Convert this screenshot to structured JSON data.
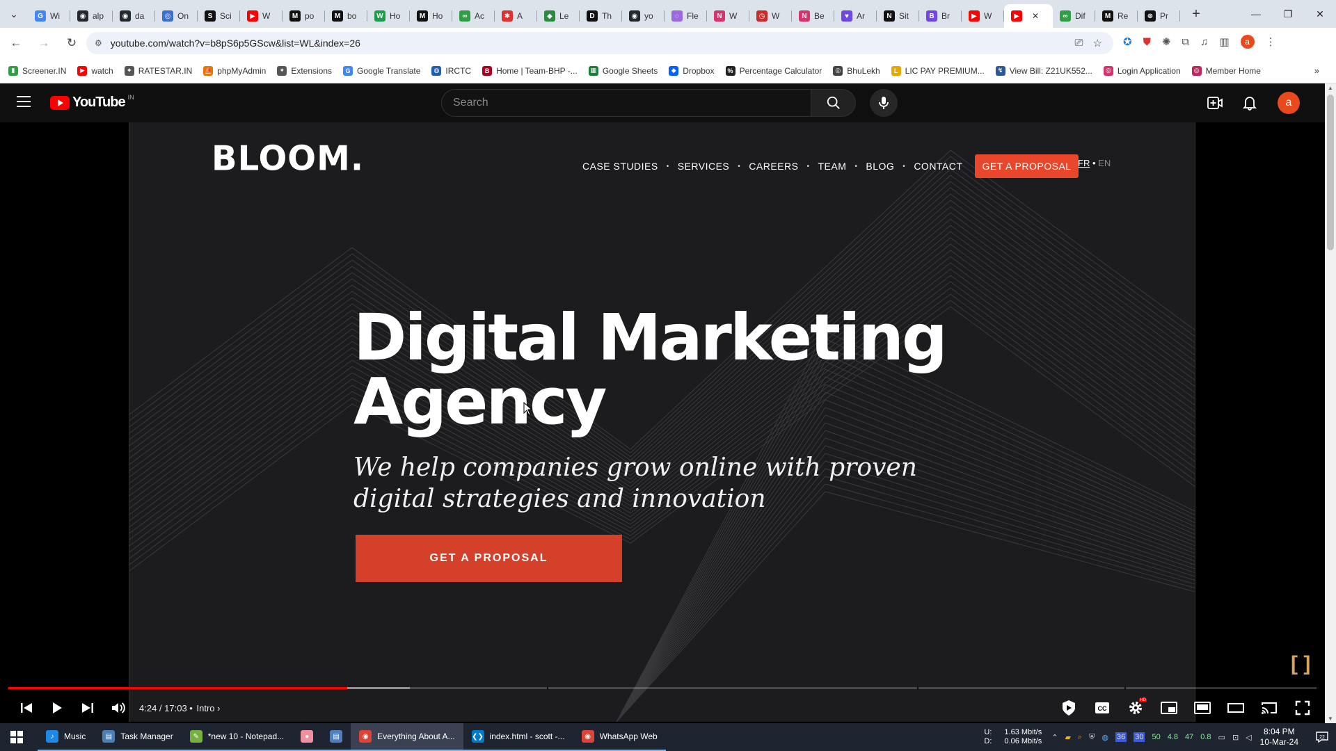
{
  "browser": {
    "tabs": [
      {
        "title": "Wi",
        "icon": "google-icon",
        "color": "#4285f4",
        "glyph": "G"
      },
      {
        "title": "alp",
        "icon": "github-icon",
        "color": "#24292f",
        "glyph": "◉"
      },
      {
        "title": "da",
        "icon": "github-icon",
        "color": "#24292f",
        "glyph": "◉"
      },
      {
        "title": "On",
        "icon": "globe-icon",
        "color": "#3b6fd4",
        "glyph": "◎"
      },
      {
        "title": "Sci",
        "icon": "s-icon",
        "color": "#111111",
        "glyph": "S"
      },
      {
        "title": "W",
        "icon": "youtube-icon",
        "color": "#ff0000",
        "glyph": "▶"
      },
      {
        "title": "po",
        "icon": "medium-icon",
        "color": "#111111",
        "glyph": "M"
      },
      {
        "title": "bo",
        "icon": "medium-icon",
        "color": "#111111",
        "glyph": "M"
      },
      {
        "title": "Ho",
        "icon": "w-icon",
        "color": "#1a9e4a",
        "glyph": "W"
      },
      {
        "title": "Ho",
        "icon": "medium-icon",
        "color": "#111111",
        "glyph": "M"
      },
      {
        "title": "Ac",
        "icon": "link-icon",
        "color": "#2f9e44",
        "glyph": "∞"
      },
      {
        "title": "A",
        "icon": "asterisk-icon",
        "color": "#e03131",
        "glyph": "✱"
      },
      {
        "title": "Le",
        "icon": "shield-icon",
        "color": "#2b8a3e",
        "glyph": "◆"
      },
      {
        "title": "Th",
        "icon": "dev-icon",
        "color": "#111111",
        "glyph": "D"
      },
      {
        "title": "yo",
        "icon": "github-icon",
        "color": "#24292f",
        "glyph": "◉"
      },
      {
        "title": "Fle",
        "icon": "circle-icon",
        "color": "#9c6ade",
        "glyph": "◌"
      },
      {
        "title": "W",
        "icon": "nn-icon",
        "color": "#d6336c",
        "glyph": "N"
      },
      {
        "title": "W",
        "icon": "clock-icon",
        "color": "#c92a2a",
        "glyph": "◷"
      },
      {
        "title": "Be",
        "icon": "nn-icon",
        "color": "#d6336c",
        "glyph": "N"
      },
      {
        "title": "Ar",
        "icon": "heart-icon",
        "color": "#7048e8",
        "glyph": "♥"
      },
      {
        "title": "Sit",
        "icon": "n-icon",
        "color": "#111111",
        "glyph": "N"
      },
      {
        "title": "Br",
        "icon": "b-icon",
        "color": "#7048e8",
        "glyph": "B"
      },
      {
        "title": "W",
        "icon": "youtube-icon",
        "color": "#ff0000",
        "glyph": "▶"
      },
      {
        "title": "",
        "icon": "youtube-icon",
        "color": "#ff0000",
        "glyph": "▶",
        "active": true
      },
      {
        "title": "Dif",
        "icon": "link-icon",
        "color": "#2f9e44",
        "glyph": "∞"
      },
      {
        "title": "Re",
        "icon": "medium-icon",
        "color": "#111111",
        "glyph": "M"
      },
      {
        "title": "Pr",
        "icon": "openai-icon",
        "color": "#111111",
        "glyph": "⊛"
      }
    ],
    "url": "youtube.com/watch?v=b8pS6p5GScw&list=WL&index=26",
    "bookmarks": [
      {
        "label": "Screener.IN",
        "icon": "chart-icon",
        "color": "#2f9e44",
        "glyph": "▮"
      },
      {
        "label": "watch",
        "icon": "youtube-icon",
        "color": "#ff0000",
        "glyph": "▶"
      },
      {
        "label": "RATESTAR.IN",
        "icon": "star-icon",
        "color": "#555555",
        "glyph": "⌖"
      },
      {
        "label": "phpMyAdmin",
        "icon": "db-icon",
        "color": "#e67700",
        "glyph": "⛵"
      },
      {
        "label": "Extensions",
        "icon": "puzzle-icon",
        "color": "#555555",
        "glyph": "✦"
      },
      {
        "label": "Google Translate",
        "icon": "translate-icon",
        "color": "#4285f4",
        "glyph": "G"
      },
      {
        "label": "IRCTC",
        "icon": "train-icon",
        "color": "#1c5fb3",
        "glyph": "◍"
      },
      {
        "label": "Home | Team-BHP -...",
        "icon": "bhp-icon",
        "color": "#b00020",
        "glyph": "B"
      },
      {
        "label": "Google Sheets",
        "icon": "sheets-icon",
        "color": "#188038",
        "glyph": "▦"
      },
      {
        "label": "Dropbox",
        "icon": "dropbox-icon",
        "color": "#0061fe",
        "glyph": "◆"
      },
      {
        "label": "Percentage Calculator",
        "icon": "percent-icon",
        "color": "#222222",
        "glyph": "%"
      },
      {
        "label": "BhuLekh",
        "icon": "globe-icon",
        "color": "#444444",
        "glyph": "◎"
      },
      {
        "label": "LIC PAY PREMIUM...",
        "icon": "lic-icon",
        "color": "#e6a800",
        "glyph": "L"
      },
      {
        "label": "View Bill: Z21UK552...",
        "icon": "bill-icon",
        "color": "#2b5797",
        "glyph": "↯"
      },
      {
        "label": "Login Application",
        "icon": "login-icon",
        "color": "#d6336c",
        "glyph": "◎"
      },
      {
        "label": "Member Home",
        "icon": "member-icon",
        "color": "#c2255c",
        "glyph": "◎"
      }
    ]
  },
  "youtube": {
    "logo_text": "YouTube",
    "country": "IN",
    "search_placeholder": "Search",
    "avatar_letter": "a",
    "accent": "#ff0000"
  },
  "video": {
    "site_logo": "BLOOM.",
    "nav": [
      "CASE STUDIES",
      "SERVICES",
      "CAREERS",
      "TEAM",
      "BLOG",
      "CONTACT"
    ],
    "nav_cta": "GET A PROPOSAL",
    "lang_active": "FR",
    "lang_sep": "•",
    "lang_other": "EN",
    "hero_title_line1": "Digital Marketing",
    "hero_title_line2": "Agency",
    "hero_subtitle": "We help companies grow online with proven digital strategies and innovation",
    "hero_cta": "GET A PROPOSAL",
    "cta_color": "#d5402a"
  },
  "player": {
    "time": "4:24 / 17:03",
    "separator": "•",
    "chapter": "Intro",
    "progress_played": 0.259,
    "progress_buffered": 0.307
  },
  "taskbar": {
    "items": [
      {
        "label": "Music",
        "icon": "music-icon",
        "color": "#1e88e5",
        "glyph": "♪"
      },
      {
        "label": "Task Manager",
        "icon": "task-manager-icon",
        "color": "#4a7fb5",
        "glyph": "▤"
      },
      {
        "label": "*new 10 - Notepad...",
        "icon": "notepad-icon",
        "color": "#76b041",
        "glyph": "✎"
      },
      {
        "label": "",
        "icon": "pig-icon",
        "color": "#f08fa0",
        "glyph": "●"
      },
      {
        "label": "",
        "icon": "file-icon",
        "color": "#4f7fbf",
        "glyph": "▤"
      },
      {
        "label": "Everything About A...",
        "icon": "chrome-icon",
        "color": "#db4437",
        "glyph": "◉"
      },
      {
        "label": "index.html - scott -...",
        "icon": "vscode-icon",
        "color": "#007acc",
        "glyph": "❮❯"
      },
      {
        "label": "WhatsApp Web",
        "icon": "chrome-icon",
        "color": "#db4437",
        "glyph": "◉"
      }
    ],
    "net_up_label": "U:",
    "net_up": "1.63 Mbit/s",
    "net_down_label": "D:",
    "net_down": "0.06 Mbit/s",
    "tray_numbers": [
      "36",
      "30",
      "50",
      "4.8",
      "47",
      "0.8"
    ],
    "time": "8:04 PM",
    "date": "10-Mar-24"
  }
}
